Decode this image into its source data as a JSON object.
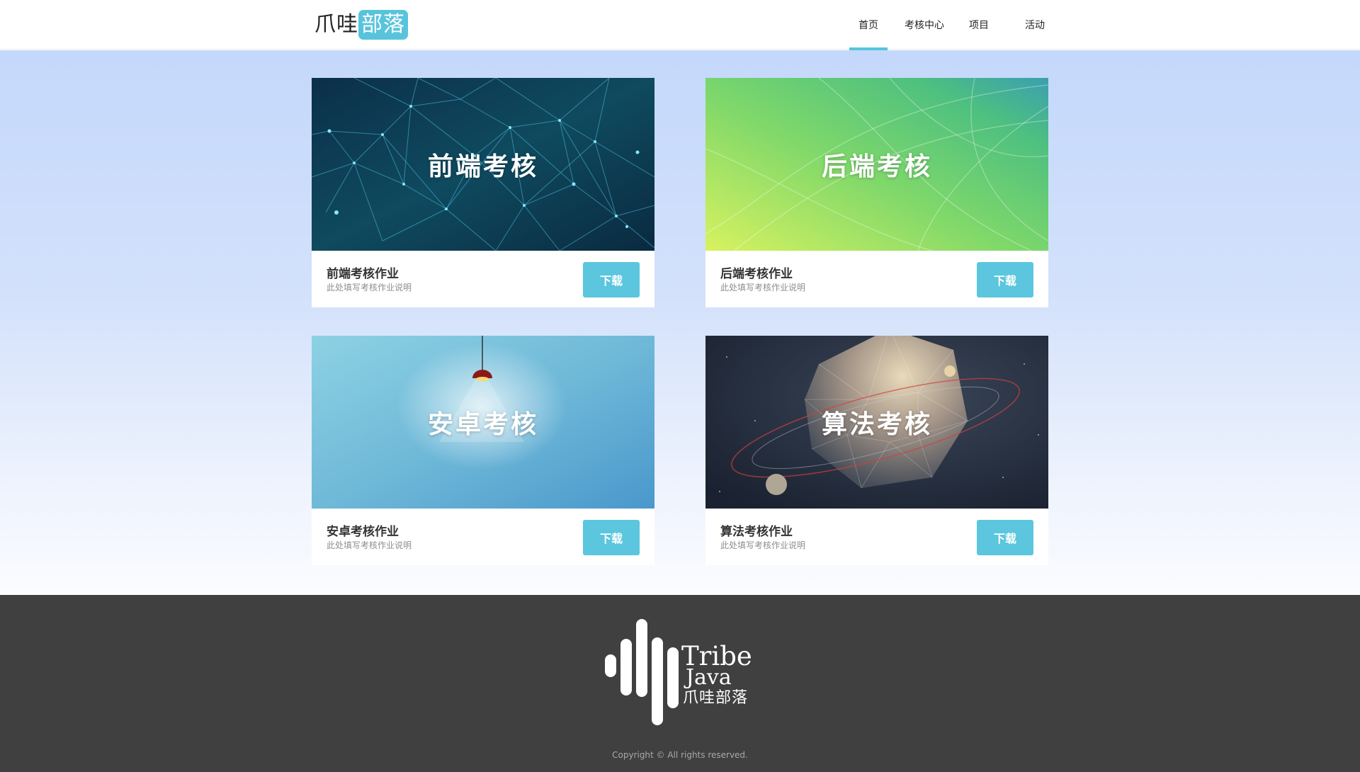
{
  "header": {
    "logo": {
      "text_dark": "爪哇",
      "text_badge": "部落"
    },
    "nav": [
      {
        "label": "首页",
        "active": true
      },
      {
        "label": "考核中心",
        "active": false
      },
      {
        "label": "项目",
        "active": false
      },
      {
        "label": "活动",
        "active": false
      }
    ]
  },
  "cards": [
    {
      "image_title": "前端考核",
      "title": "前端考核作业",
      "description": "此处填写考核作业说明",
      "button": "下载"
    },
    {
      "image_title": "后端考核",
      "title": "后端考核作业",
      "description": "此处填写考核作业说明",
      "button": "下载"
    },
    {
      "image_title": "安卓考核",
      "title": "安卓考核作业",
      "description": "此处填写考核作业说明",
      "button": "下载"
    },
    {
      "image_title": "算法考核",
      "title": "算法考核作业",
      "description": "此处填写考核作业说明",
      "button": "下载"
    }
  ],
  "footer": {
    "logo_line1": "Tribe",
    "logo_line2": "Java",
    "logo_line3": "爪哇部落",
    "copyright": "Copyright © All rights reserved."
  },
  "colors": {
    "accent": "#5bc6de",
    "footer_bg": "#404040",
    "page_gradient_top": "#c4d8fb"
  }
}
